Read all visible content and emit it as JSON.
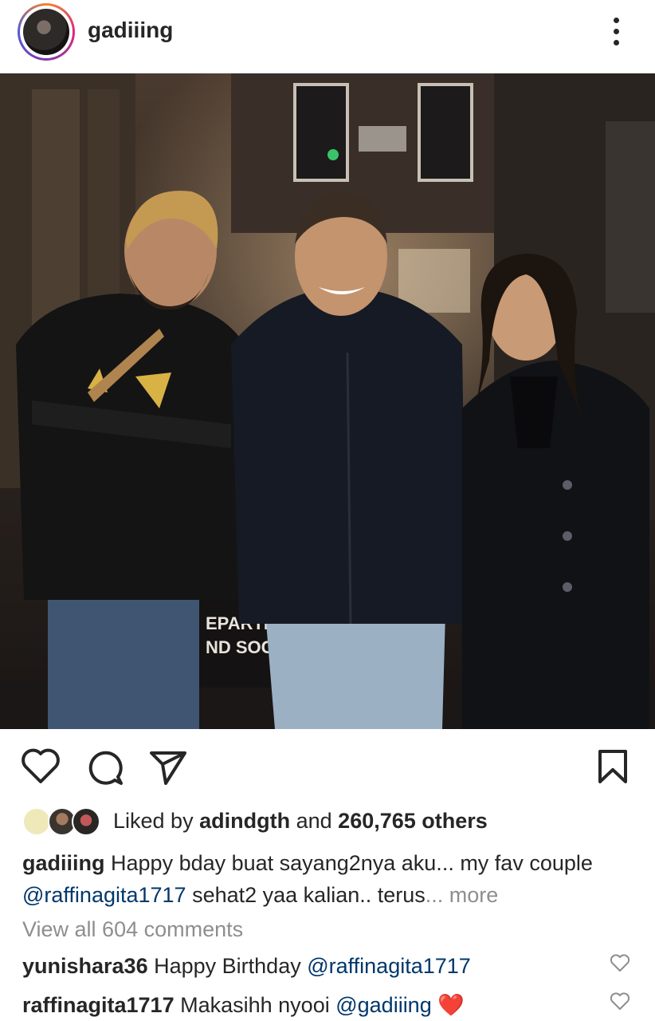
{
  "post": {
    "username": "gadiiing",
    "liked_by_prefix": "Liked by",
    "liked_by_user": "adindgth",
    "liked_by_and": "and",
    "liked_by_count": "260,765 others",
    "caption_user": "gadiiing",
    "caption_text_1": "Happy bday buat sayang2nya aku... my fav couple",
    "caption_mention": "@raffinagita1717",
    "caption_text_2": "sehat2 yaa kalian.. terus",
    "caption_more": "... more",
    "view_all_comments": "View all 604 comments",
    "photo_sign_line1": "EPARTI",
    "photo_sign_line2": "ND SOC"
  },
  "comments": [
    {
      "user": "yunishara36",
      "text": "Happy Birthday",
      "mention": "@raffinagita1717",
      "emoji": ""
    },
    {
      "user": "raffinagita1717",
      "text": "Makasihh nyooi",
      "mention": "@gadiiing",
      "emoji": "❤️"
    }
  ],
  "icons": {
    "like": "heart-outline-icon",
    "comment": "comment-icon",
    "share": "send-icon",
    "save": "bookmark-icon",
    "menu": "more-vertical-icon"
  },
  "colors": {
    "text": "#262626",
    "mention": "#00376b",
    "muted": "#8e8e8e",
    "heart": "#ed1c24"
  }
}
